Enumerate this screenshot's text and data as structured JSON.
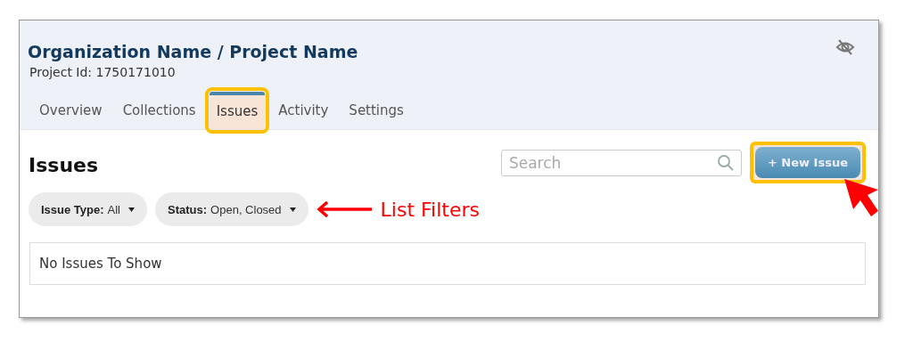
{
  "header": {
    "title": "Organization Name / Project Name",
    "project_id": "Project Id: 1750171010"
  },
  "tabs": [
    {
      "label": "Overview",
      "selected": false,
      "highlighted": false
    },
    {
      "label": "Collections",
      "selected": false,
      "highlighted": false
    },
    {
      "label": "Issues",
      "selected": true,
      "highlighted": true
    },
    {
      "label": "Activity",
      "selected": false,
      "highlighted": false
    },
    {
      "label": "Settings",
      "selected": false,
      "highlighted": false
    }
  ],
  "heading": "Issues",
  "search": {
    "placeholder": "Search"
  },
  "new_button": {
    "label": "+ New Issue",
    "highlighted": true
  },
  "filters": [
    {
      "label": "Issue Type:",
      "value": "All"
    },
    {
      "label": "Status:",
      "value": "Open, Closed"
    }
  ],
  "annotation": {
    "text": "List Filters"
  },
  "empty_message": "No Issues To Show"
}
